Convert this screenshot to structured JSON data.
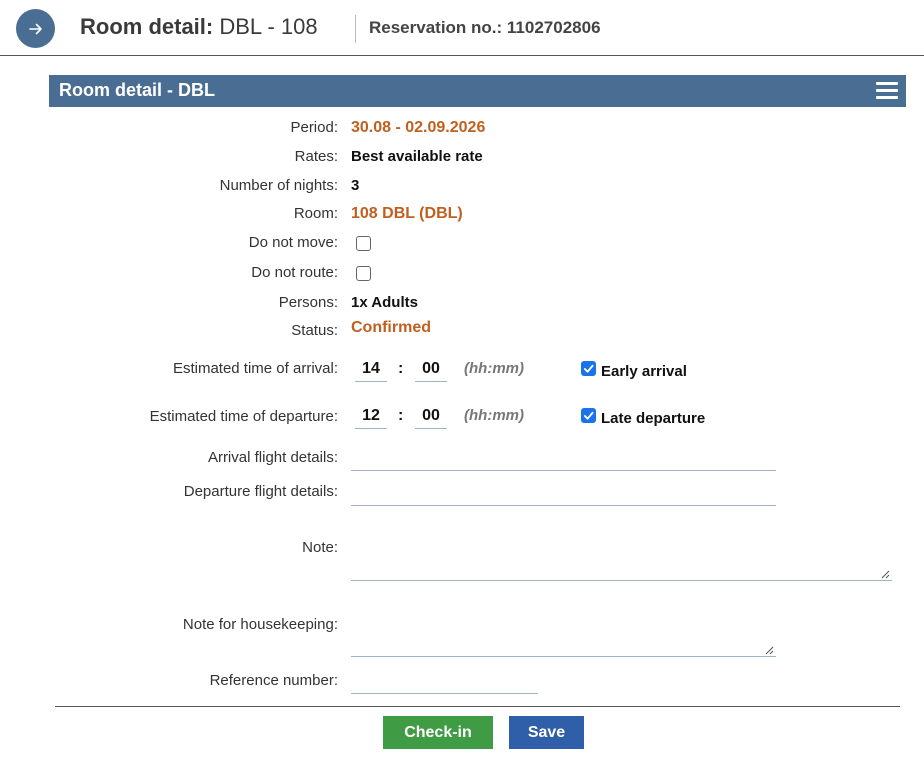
{
  "header": {
    "title_prefix": "Room detail:",
    "title_room": "DBL - 108",
    "reservation": "Reservation no.: 1102702806",
    "back_icon": "arrow-right-icon"
  },
  "panel": {
    "title": "Room detail - DBL",
    "menu_icon": "hamburger-menu-icon"
  },
  "fields": {
    "period": {
      "label": "Period:",
      "value": "30.08 - 02.09.2026"
    },
    "rates": {
      "label": "Rates:",
      "value": "Best available rate"
    },
    "nights": {
      "label": "Number of nights:",
      "value": "3"
    },
    "room": {
      "label": "Room:",
      "value": "108 DBL (DBL)"
    },
    "do_not_move": {
      "label": "Do not move:",
      "checked": false
    },
    "do_not_route": {
      "label": "Do not route:",
      "checked": false
    },
    "persons": {
      "label": "Persons:",
      "value": "1x Adults"
    },
    "status": {
      "label": "Status:",
      "value": "Confirmed"
    },
    "arrival_time": {
      "label": "Estimated time of arrival:",
      "hours": "14",
      "minutes": "00",
      "hint": "(hh:mm)",
      "checkbox_label": "Early arrival",
      "checked": true
    },
    "departure_time": {
      "label": "Estimated time of departure:",
      "hours": "12",
      "minutes": "00",
      "hint": "(hh:mm)",
      "checkbox_label": "Late departure",
      "checked": true
    },
    "arrival_flight": {
      "label": "Arrival flight details:",
      "value": ""
    },
    "departure_flight": {
      "label": "Departure flight details:",
      "value": ""
    },
    "note": {
      "label": "Note:",
      "value": ""
    },
    "housekeeping_note": {
      "label": "Note for housekeeping:",
      "value": ""
    },
    "reference_number": {
      "label": "Reference number:",
      "value": ""
    }
  },
  "colon": ":",
  "buttons": {
    "checkin": "Check-in",
    "save": "Save"
  },
  "colors": {
    "accent": "#4a6d94",
    "highlight": "#c0601e",
    "checkin": "#3f9c45",
    "save": "#2e5fa8"
  }
}
